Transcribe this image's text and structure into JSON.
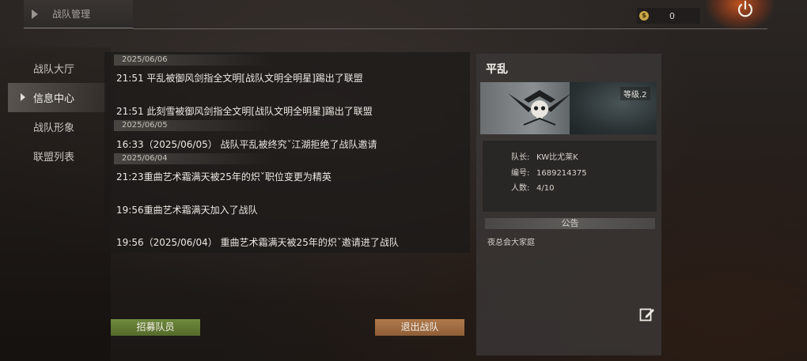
{
  "header": {
    "title": "战队管理"
  },
  "currency": {
    "icon": "coin-icon",
    "value": "0"
  },
  "sidebar": {
    "items": [
      {
        "label": "战队大厅",
        "active": false
      },
      {
        "label": "信息中心",
        "active": true
      },
      {
        "label": "战队形象",
        "active": false
      },
      {
        "label": "联盟列表",
        "active": false
      }
    ]
  },
  "log": {
    "dates": [
      "2025/06/06",
      "2025/06/05",
      "2025/06/04"
    ],
    "entries": [
      "21:51 平乱被御风剑指全文明[战队文明全明星]踢出了联盟",
      "21:51 此刻雪被御风剑指全文明[战队文明全明星]踢出了联盟",
      "16:33（2025/06/05） 战队平乱被终究ˇ江湖拒绝了战队邀请",
      "21:23重曲艺术霜满天被25年的炽ˇ职位变更为精英",
      "19:56重曲艺术霜满天加入了战队",
      "19:56（2025/06/04） 重曲艺术霜满天被25年的炽ˇ邀请进了战队"
    ]
  },
  "buttons": {
    "recruit": "招募队员",
    "leave": "退出战队"
  },
  "team": {
    "name": "平乱",
    "level": "等级.2",
    "captain_label": "队长:",
    "captain": "KW比尤莱K",
    "id_label": "编号:",
    "id": "1689214375",
    "members_label": "人数:",
    "members": "4/10",
    "notice_title": "公告",
    "notice": "夜总会大家庭"
  },
  "colors": {
    "recruit": "#6f8a3d",
    "leave": "#b07a4c",
    "coin": "#c9a646"
  }
}
